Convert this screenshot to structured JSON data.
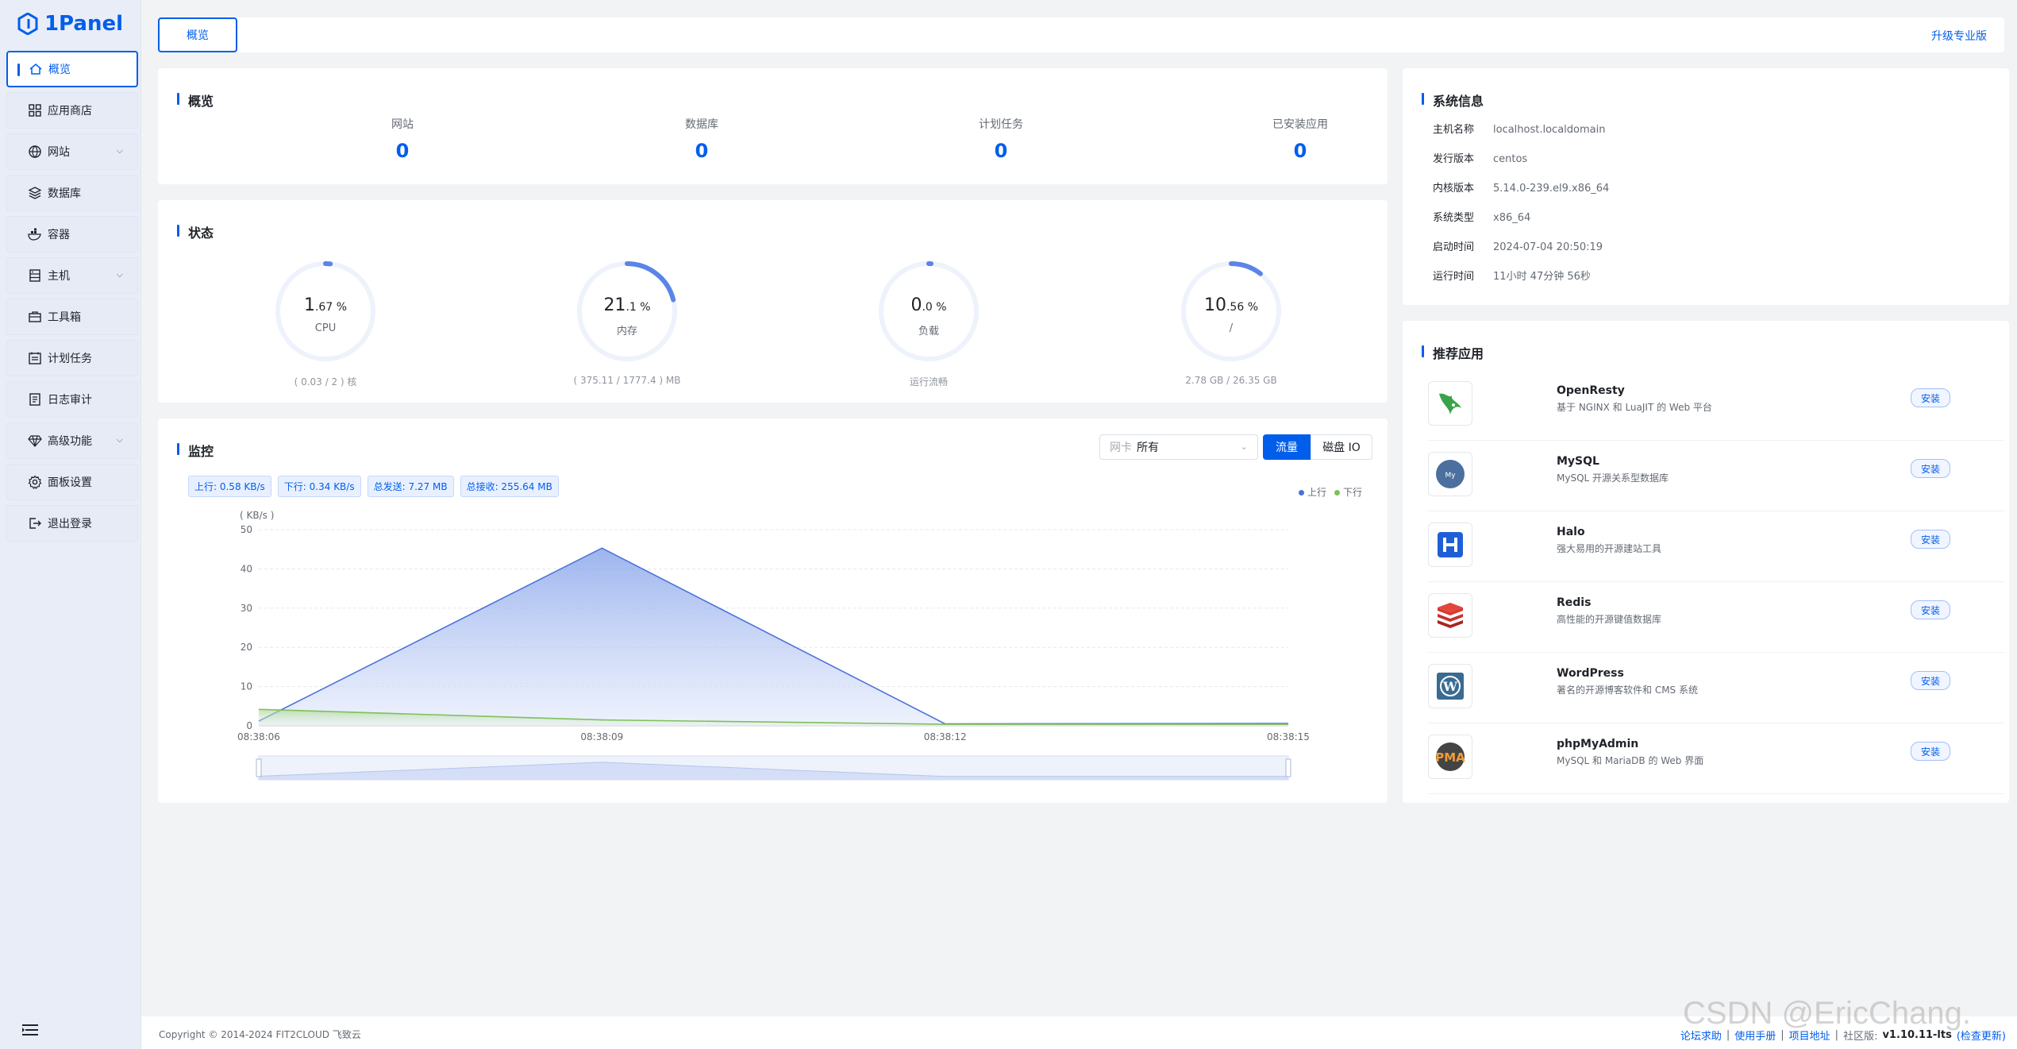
{
  "brand": {
    "name": "1Panel"
  },
  "sidebar": {
    "items": [
      {
        "label": "概览",
        "icon": "home-icon",
        "active": true
      },
      {
        "label": "应用商店",
        "icon": "apps-grid-icon"
      },
      {
        "label": "网站",
        "icon": "globe-icon",
        "expandable": true
      },
      {
        "label": "数据库",
        "icon": "database-icon"
      },
      {
        "label": "容器",
        "icon": "docker-icon"
      },
      {
        "label": "主机",
        "icon": "server-icon",
        "expandable": true
      },
      {
        "label": "工具箱",
        "icon": "toolbox-icon"
      },
      {
        "label": "计划任务",
        "icon": "calendar-icon"
      },
      {
        "label": "日志审计",
        "icon": "log-icon"
      },
      {
        "label": "高级功能",
        "icon": "diamond-icon",
        "expandable": true
      },
      {
        "label": "面板设置",
        "icon": "gear-icon"
      },
      {
        "label": "退出登录",
        "icon": "logout-icon"
      }
    ]
  },
  "header": {
    "tab": "概览",
    "upgrade": "升级专业版"
  },
  "overview": {
    "title": "概览",
    "items": [
      {
        "label": "网站",
        "value": "0"
      },
      {
        "label": "数据库",
        "value": "0"
      },
      {
        "label": "计划任务",
        "value": "0"
      },
      {
        "label": "已安装应用",
        "value": "0"
      }
    ]
  },
  "status": {
    "title": "状态",
    "gauges": [
      {
        "int": "1",
        "dec": ".67 %",
        "name": "CPU",
        "sub": "( 0.03 / 2 ) 核",
        "percent": 1.67
      },
      {
        "int": "21",
        "dec": ".1 %",
        "name": "内存",
        "sub": "( 375.11 / 1777.4 ) MB",
        "percent": 21.1
      },
      {
        "int": "0",
        "dec": ".0 %",
        "name": "负载",
        "sub": "运行流畅",
        "percent": 0.0
      },
      {
        "int": "10",
        "dec": ".56 %",
        "name": "/",
        "sub": "2.78 GB / 26.35 GB",
        "percent": 10.56
      }
    ]
  },
  "monitor": {
    "title": "监控",
    "nic_placeholder": "网卡",
    "nic_value": "所有",
    "btn_flow": "流量",
    "btn_disk": "磁盘 IO",
    "tags": {
      "up": "上行: 0.58 KB/s",
      "down": "下行: 0.34 KB/s",
      "sent": "总发送: 7.27 MB",
      "recv": "总接收: 255.64 MB"
    },
    "legend": {
      "up": "上行",
      "down": "下行"
    }
  },
  "chart_data": {
    "type": "area",
    "ylabel": "( KB/s )",
    "x": [
      "08:38:06",
      "08:38:09",
      "08:38:12",
      "08:38:15"
    ],
    "ylim": [
      0,
      50
    ],
    "yticks": [
      0,
      10,
      20,
      30,
      40,
      50
    ],
    "series": [
      {
        "name": "上行",
        "color": "#4a72d8",
        "values": [
          1.2,
          45.3,
          0.5,
          0.6
        ]
      },
      {
        "name": "下行",
        "color": "#7fbf5c",
        "values": [
          4.2,
          1.5,
          0.4,
          0.4
        ]
      }
    ],
    "grid": true,
    "legend": "top-right"
  },
  "system_info": {
    "title": "系统信息",
    "rows": [
      {
        "k": "主机名称",
        "v": "localhost.localdomain"
      },
      {
        "k": "发行版本",
        "v": "centos"
      },
      {
        "k": "内核版本",
        "v": "5.14.0-239.el9.x86_64"
      },
      {
        "k": "系统类型",
        "v": "x86_64"
      },
      {
        "k": "启动时间",
        "v": "2024-07-04 20:50:19"
      },
      {
        "k": "运行时间",
        "v": "11小时 47分钟 56秒"
      }
    ]
  },
  "apps": {
    "title": "推荐应用",
    "install_label": "安装",
    "items": [
      {
        "name": "OpenResty",
        "desc": "基于 NGINX 和 LuaJIT 的 Web 平台",
        "icon": "openresty-icon"
      },
      {
        "name": "MySQL",
        "desc": "MySQL 开源关系型数据库",
        "icon": "mysql-icon"
      },
      {
        "name": "Halo",
        "desc": "强大易用的开源建站工具",
        "icon": "halo-icon"
      },
      {
        "name": "Redis",
        "desc": "高性能的开源键值数据库",
        "icon": "redis-icon"
      },
      {
        "name": "WordPress",
        "desc": "著名的开源博客软件和 CMS 系统",
        "icon": "wordpress-icon"
      },
      {
        "name": "phpMyAdmin",
        "desc": "MySQL 和 MariaDB 的 Web 界面",
        "icon": "phpmyadmin-icon"
      }
    ]
  },
  "footer": {
    "copyright": "Copyright © 2014-2024 FIT2CLOUD 飞致云",
    "links": [
      "论坛求助",
      "使用手册",
      "项目地址"
    ],
    "edition": "社区版:",
    "version": "v1.10.11-lts",
    "check_update": "(检查更新)"
  },
  "watermark": "CSDN @EricChang."
}
